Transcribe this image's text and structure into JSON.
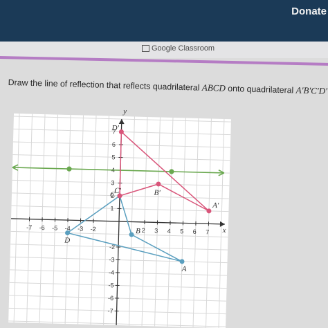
{
  "header": {
    "donate_label": "Donate",
    "classroom_link": "Google Classroom"
  },
  "question": {
    "prefix": "Draw the line of reflection that reflects quadrilateral ",
    "original_name": "ABCD",
    "middle": " onto quadrilateral ",
    "image_name": "A′B′C′D′",
    "suffix": "."
  },
  "graph": {
    "x_axis_label": "x",
    "y_axis_label": "y",
    "x_range": [
      -8,
      8
    ],
    "y_range": [
      -8,
      8
    ],
    "x_ticks": [
      "-7",
      "-6",
      "-5",
      "-4",
      "-3",
      "-2",
      "2",
      "3",
      "4",
      "5",
      "6",
      "7"
    ],
    "x_tick_values": [
      -7,
      -6,
      -5,
      -4,
      -3,
      -2,
      2,
      3,
      4,
      5,
      6,
      7
    ],
    "y_ticks": [
      "7",
      "6",
      "5",
      "4",
      "3",
      "2",
      "1",
      "-2",
      "-3",
      "-4",
      "-5",
      "-6",
      "-7"
    ],
    "y_tick_values": [
      7,
      6,
      5,
      4,
      3,
      2,
      1,
      -2,
      -3,
      -4,
      -5,
      -6,
      -7
    ],
    "original": {
      "color": "#5a9fbf",
      "points": [
        {
          "label": "A",
          "x": 5,
          "y": -3
        },
        {
          "label": "B",
          "x": 1,
          "y": -1
        },
        {
          "label": "C",
          "x": 0,
          "y": 2
        },
        {
          "label": "D",
          "x": -4,
          "y": -1
        }
      ]
    },
    "image": {
      "color": "#d9557a",
      "points": [
        {
          "label": "A'",
          "x": 7,
          "y": 1
        },
        {
          "label": "B'",
          "x": 3,
          "y": 3
        },
        {
          "label": "C'",
          "x": 0,
          "y": 2
        },
        {
          "label": "D'",
          "x": 0,
          "y": 7
        }
      ]
    },
    "reflection_line": {
      "color": "#6aa84f",
      "y": 4,
      "points": [
        {
          "x": -4,
          "y": 4
        },
        {
          "x": 4,
          "y": 4
        }
      ]
    },
    "grid": true
  }
}
